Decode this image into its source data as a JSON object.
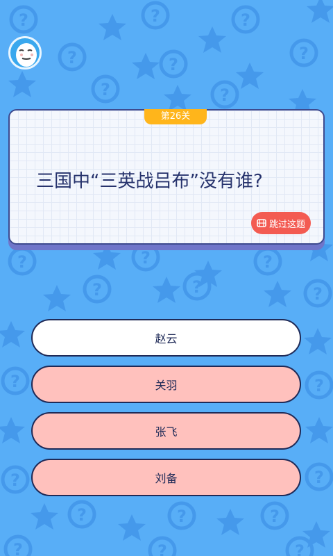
{
  "game": {
    "level_label": "第26关",
    "question": "三国中“三英战吕布”没有谁?",
    "skip_label": "跳过这题"
  },
  "answers": [
    {
      "label": "赵云",
      "state": "default"
    },
    {
      "label": "关羽",
      "state": "faded"
    },
    {
      "label": "张飞",
      "state": "faded"
    },
    {
      "label": "刘备",
      "state": "faded"
    }
  ],
  "colors": {
    "background": "#58aef7",
    "pattern": "#4599eb",
    "level_tab": "#ffb51b",
    "question_text": "#27336d",
    "skip_button": "#f35b52",
    "answer_default": "#ffffff",
    "answer_faded": "#ffc1bd"
  },
  "icons": {
    "background_pattern": [
      "question-mark-icon",
      "star-icon"
    ],
    "avatar": "cartoon-face-avatar",
    "skip": "video-ad-icon"
  }
}
